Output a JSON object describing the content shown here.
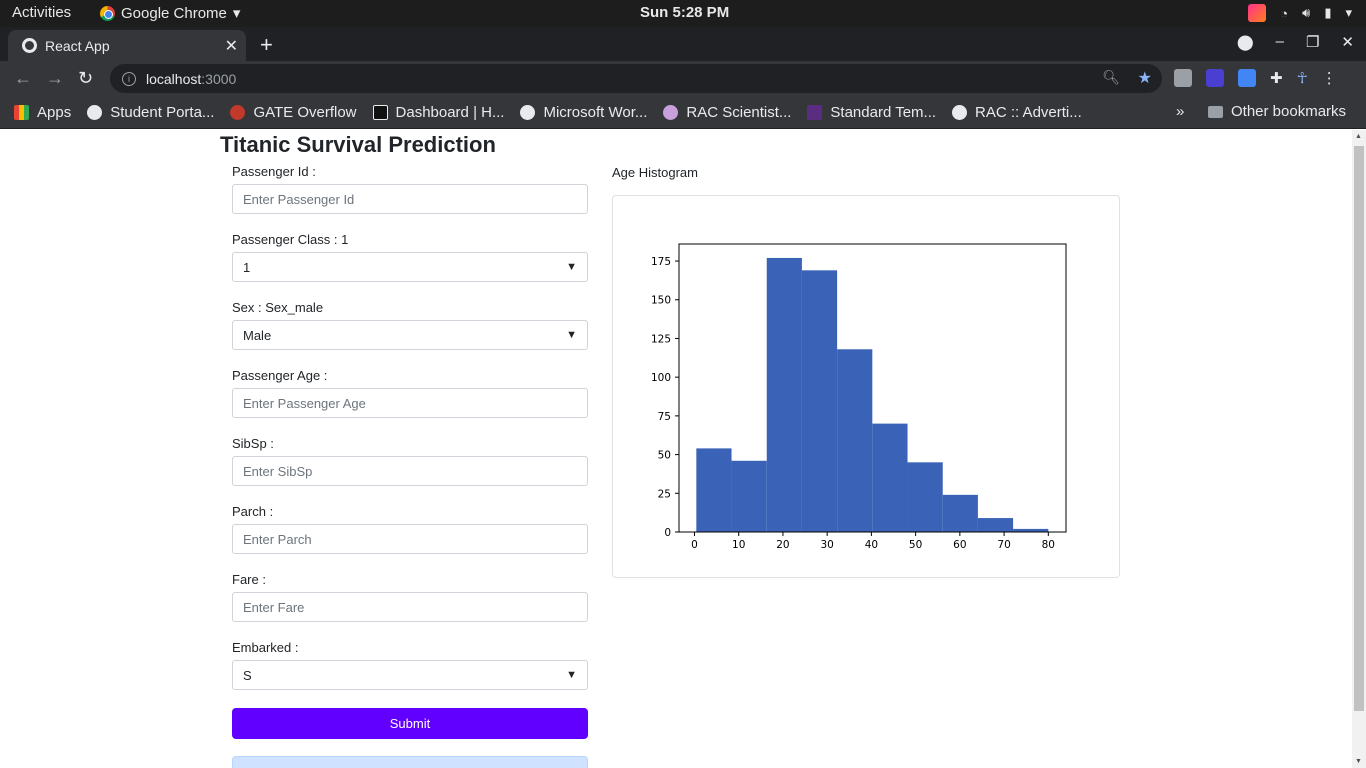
{
  "topbar": {
    "activities": "Activities",
    "app_name": "Google Chrome",
    "clock": "Sun  5:28 PM"
  },
  "browser": {
    "tab_title": "React App",
    "url_host": "localhost",
    "url_port": ":3000",
    "bookmarks": [
      {
        "label": "Apps",
        "icon": "apps-grid-icon"
      },
      {
        "label": "Student Porta...",
        "icon": "globe-icon"
      },
      {
        "label": "GATE Overflow",
        "icon": "gate-icon"
      },
      {
        "label": "Dashboard | H...",
        "icon": "hackerearth-icon"
      },
      {
        "label": "Microsoft Wor...",
        "icon": "globe-icon"
      },
      {
        "label": "RAC Scientist...",
        "icon": "rac-icon"
      },
      {
        "label": "Standard Tem...",
        "icon": "doc-icon"
      },
      {
        "label": "RAC :: Adverti...",
        "icon": "globe-icon"
      }
    ],
    "more_bookmarks": "»",
    "other_bookmarks": "Other bookmarks"
  },
  "page": {
    "title": "Titanic Survival Prediction",
    "form": {
      "passenger_id_label": "Passenger Id :",
      "passenger_id_placeholder": "Enter Passenger Id",
      "pclass_label": "Passenger Class : 1",
      "pclass_value": "1",
      "sex_label": "Sex : Sex_male",
      "sex_value": "Male",
      "age_label": "Passenger Age :",
      "age_placeholder": "Enter Passenger Age",
      "sibsp_label": "SibSp :",
      "sibsp_placeholder": "Enter SibSp",
      "parch_label": "Parch :",
      "parch_placeholder": "Enter Parch",
      "fare_label": "Fare :",
      "fare_placeholder": "Enter Fare",
      "embarked_label": "Embarked :",
      "embarked_value": "S",
      "submit_label": "Submit"
    },
    "histogram_title": "Age Histogram"
  },
  "colors": {
    "accent": "#6200ff",
    "bar": "#3a62b6"
  },
  "chart_data": {
    "type": "bar",
    "title": "",
    "xlabel": "",
    "ylabel": "",
    "bin_edges": [
      0.42,
      8.38,
      16.34,
      24.29,
      32.25,
      40.21,
      48.17,
      56.13,
      64.08,
      72.04,
      80.0
    ],
    "values": [
      54,
      46,
      177,
      169,
      118,
      70,
      45,
      24,
      9,
      2
    ],
    "xlim": [
      -3.5,
      84
    ],
    "ylim": [
      0,
      186
    ],
    "xticks": [
      0,
      10,
      20,
      30,
      40,
      50,
      60,
      70,
      80
    ],
    "yticks": [
      0,
      25,
      50,
      75,
      100,
      125,
      150,
      175
    ],
    "grid": false
  }
}
